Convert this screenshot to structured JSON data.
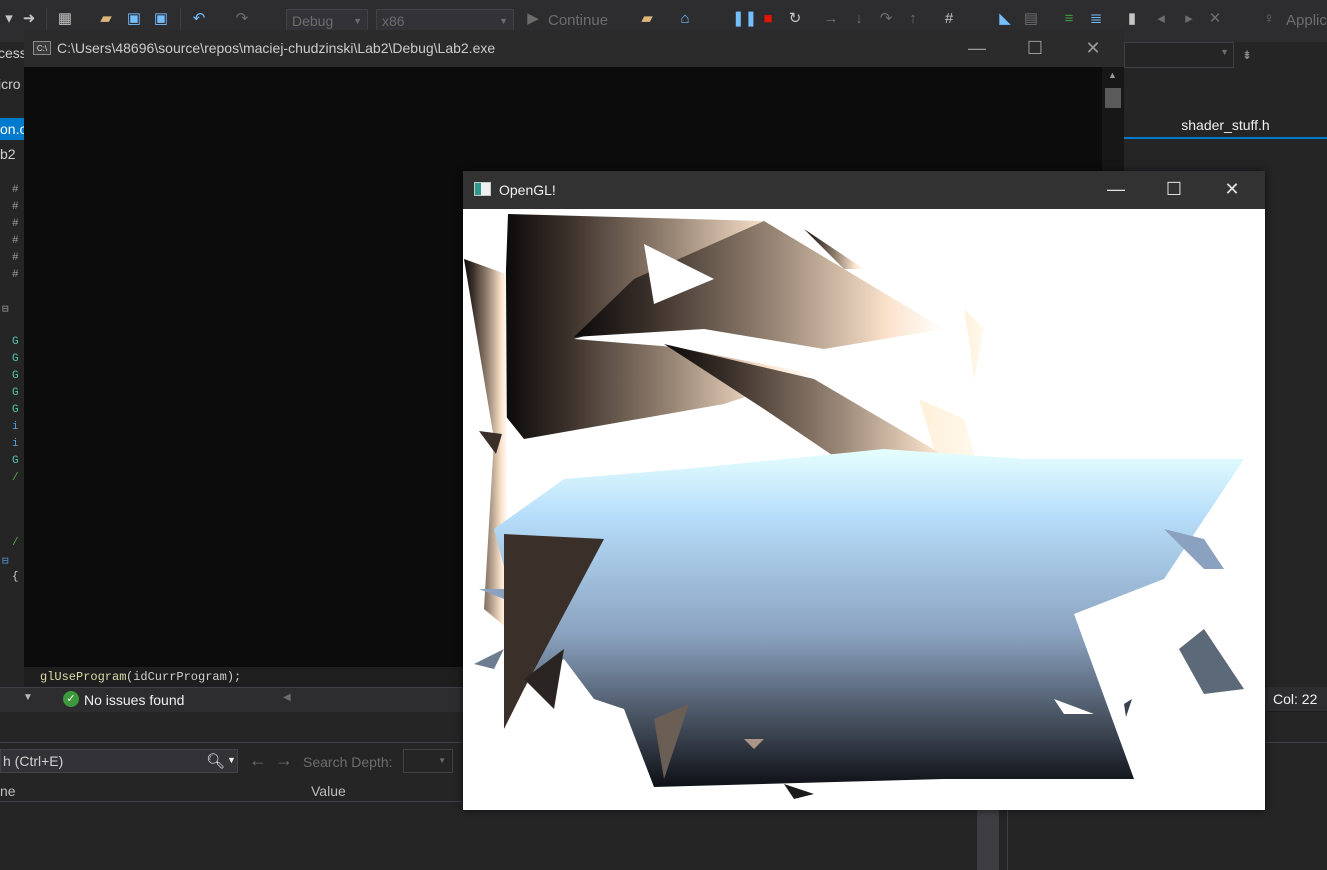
{
  "toolbar": {
    "config": "Debug",
    "platform": "x86",
    "continue_label": "Continue",
    "appinsights_label": "Applic"
  },
  "left_strip": {
    "fragments": [
      "cess",
      "icro",
      "on.c",
      "b2"
    ]
  },
  "console": {
    "title": "C:\\Users\\48696\\source\\repos\\maciej-chudzinski\\Lab2\\Debug\\Lab2.exe",
    "icon_text": "C:\\"
  },
  "opengl_window": {
    "title": "OpenGL!"
  },
  "editor": {
    "tab_label": "shader_stuff.h",
    "code_line_fn": "glUseProgram",
    "code_line_rest": "(idCurrProgram);",
    "status_issues": "No issues found",
    "status_col": "Col: 22"
  },
  "lower_pane": {
    "search_placeholder": "h (Ctrl+E)",
    "search_depth_label": "Search Depth:",
    "col_name": "ne",
    "col_value": "Value"
  },
  "colors": {
    "vs_bg": "#1e1e1e",
    "accent": "#007acc",
    "success": "#3c9a3c"
  }
}
